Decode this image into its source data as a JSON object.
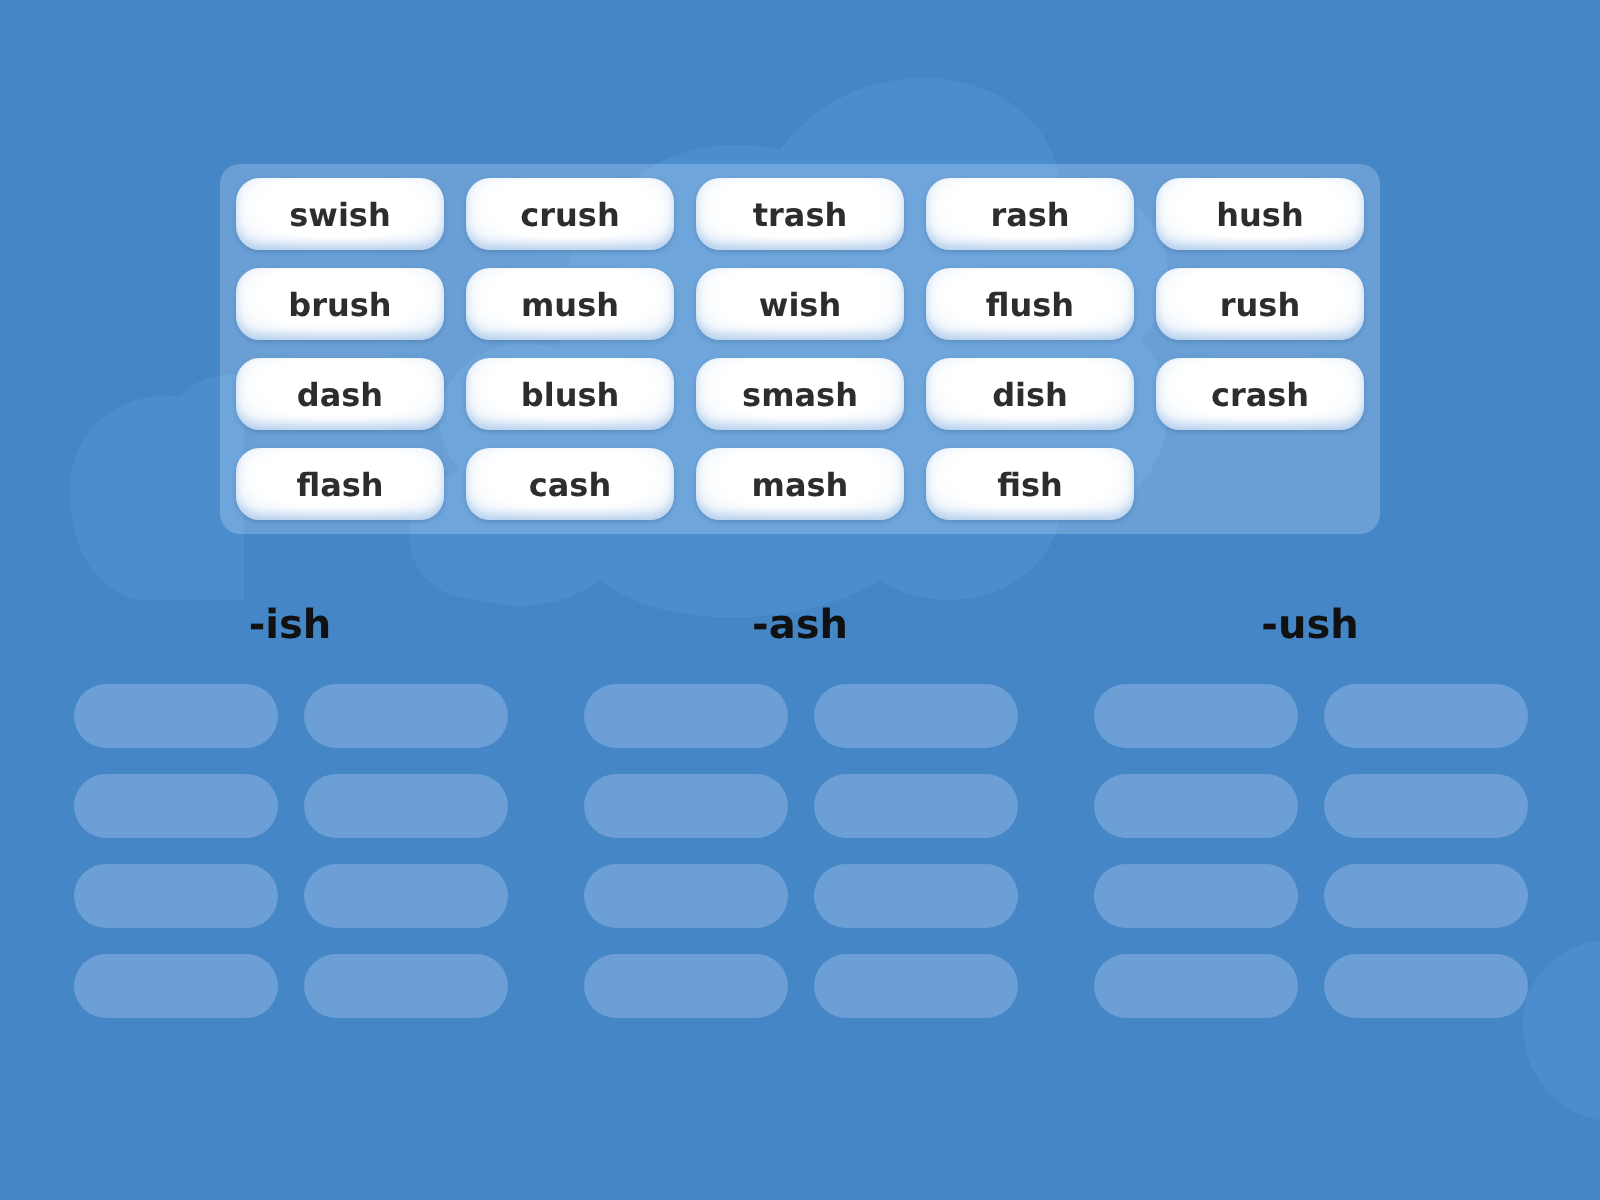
{
  "word_bank": {
    "tiles": [
      "swish",
      "crush",
      "trash",
      "rash",
      "hush",
      "brush",
      "mush",
      "wish",
      "flush",
      "rush",
      "dash",
      "blush",
      "smash",
      "dish",
      "crash",
      "flash",
      "cash",
      "mash",
      "fish"
    ]
  },
  "groups": [
    {
      "heading": "-ish",
      "slots": [
        {
          "kind": "empty"
        },
        {
          "kind": "empty"
        },
        {
          "kind": "empty"
        },
        {
          "kind": "empty"
        },
        {
          "kind": "empty"
        },
        {
          "kind": "empty"
        },
        {
          "kind": "empty"
        },
        {
          "kind": "empty"
        }
      ]
    },
    {
      "heading": "-ash",
      "slots": [
        {
          "kind": "empty"
        },
        {
          "kind": "empty"
        },
        {
          "kind": "empty"
        },
        {
          "kind": "empty"
        },
        {
          "kind": "empty"
        },
        {
          "kind": "empty"
        },
        {
          "kind": "empty"
        },
        {
          "kind": "empty"
        }
      ]
    },
    {
      "heading": "-ush",
      "slots": [
        {
          "kind": "empty"
        },
        {
          "kind": "empty"
        },
        {
          "kind": "empty"
        },
        {
          "kind": "empty"
        },
        {
          "kind": "empty"
        },
        {
          "kind": "empty"
        },
        {
          "kind": "empty"
        },
        {
          "kind": "empty"
        }
      ]
    }
  ]
}
